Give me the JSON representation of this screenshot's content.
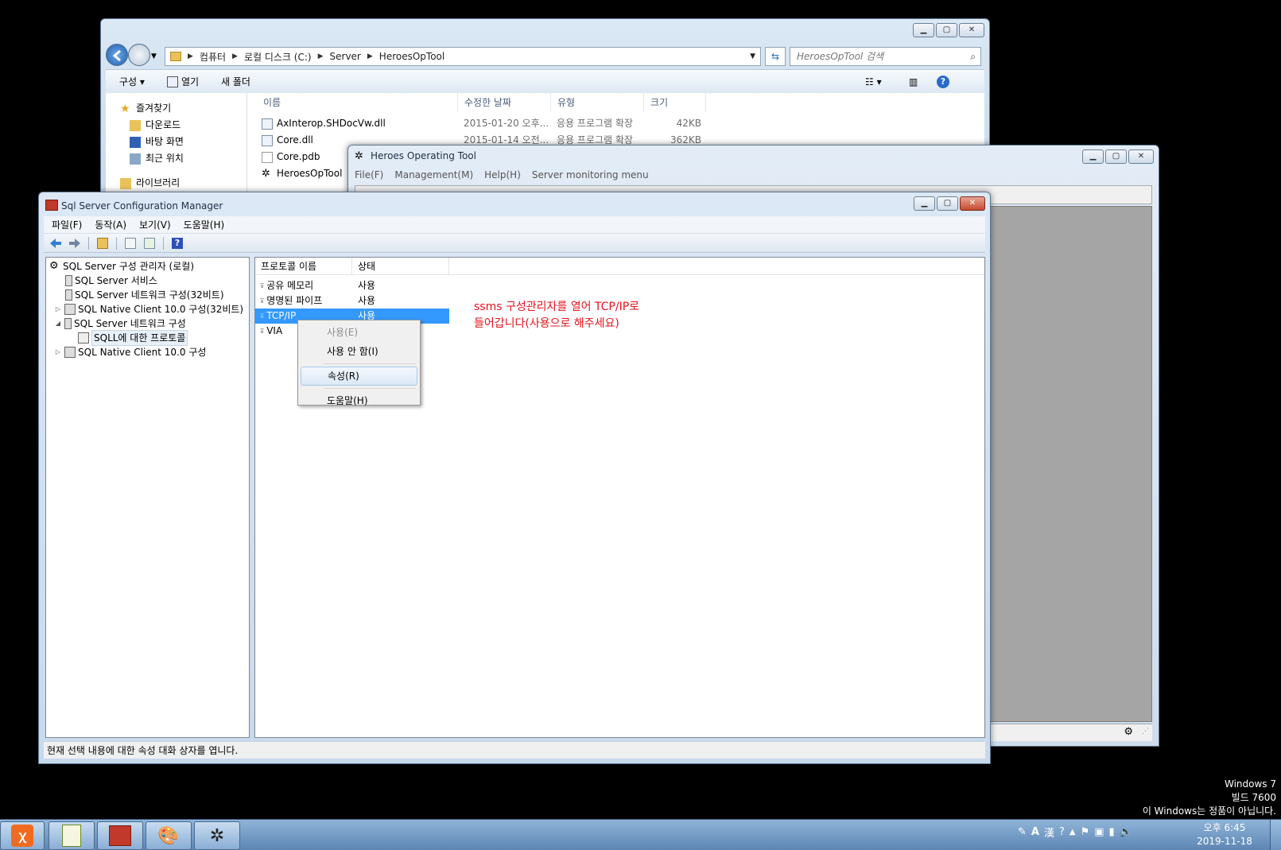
{
  "explorer": {
    "breadcrumb": [
      "컴퓨터",
      "로컬 디스크 (C:)",
      "Server",
      "HeroesOpTool"
    ],
    "search_placeholder": "HeroesOpTool 검색",
    "toolbar": {
      "organize": "구성",
      "open": "열기",
      "new_folder": "새 폴더"
    },
    "nav": {
      "favorites": "즐겨찾기",
      "downloads": "다운로드",
      "desktop": "바탕 화면",
      "recent": "최근 위치",
      "libraries": "라이브러리"
    },
    "columns": {
      "name": "이름",
      "date": "수정한 날짜",
      "type": "유형",
      "size": "크기"
    },
    "files": [
      {
        "name": "AxInterop.SHDocVw.dll",
        "date": "2015-01-20 오후...",
        "type": "응용 프로그램 확장",
        "size": "42KB"
      },
      {
        "name": "Core.dll",
        "date": "2015-01-14 오전...",
        "type": "응용 프로그램 확장",
        "size": "362KB"
      },
      {
        "name": "Core.pdb",
        "date": "",
        "type": "",
        "size": ""
      },
      {
        "name": "HeroesOpTool",
        "date": "",
        "type": "",
        "size": ""
      }
    ]
  },
  "heroes": {
    "title": "Heroes Operating Tool",
    "menu": {
      "file": "File(F)",
      "management": "Management(M)",
      "help": "Help(H)",
      "monitor": "Server monitoring menu"
    }
  },
  "sscm": {
    "title": "Sql Server Configuration Manager",
    "menu": {
      "file": "파일(F)",
      "action": "동작(A)",
      "view": "보기(V)",
      "help": "도움말(H)"
    },
    "tree": {
      "root": "SQL Server 구성 관리자 (로컬)",
      "services": "SQL Server 서비스",
      "net32": "SQL Server 네트워크 구성(32비트)",
      "native32": "SQL Native Client 10.0 구성(32비트)",
      "net": "SQL Server 네트워크 구성",
      "protocols": "SQLL에 대한 프로토콜",
      "native": "SQL Native Client 10.0 구성"
    },
    "columns": {
      "protocol": "프로토콜 이름",
      "status": "상태"
    },
    "rows": [
      {
        "name": "공유 메모리",
        "status": "사용"
      },
      {
        "name": "명명된 파이프",
        "status": "사용"
      },
      {
        "name": "TCP/IP",
        "status": "사용"
      },
      {
        "name": "VIA",
        "status": ""
      }
    ],
    "annotation": {
      "line1": "ssms 구성관리자를 열어 TCP/IP로",
      "line2": "들어갑니다(사용으로 해주세요)"
    },
    "status_text": "현재 선택 내용에 대한 속성 대화 상자를 엽니다."
  },
  "context_menu": {
    "enable": "사용(E)",
    "disable": "사용 안 함(I)",
    "properties": "속성(R)",
    "help": "도움말(H)"
  },
  "watermark": {
    "line1": "Windows 7",
    "line2": "빌드 7600",
    "line3": "이 Windows는 정품이 아닙니다."
  },
  "taskbar": {
    "time": "오후 6:45",
    "date": "2019-11-18",
    "ime_a": "A",
    "ime_han": "漢"
  },
  "colors": {
    "selection": "#3399ff",
    "annotation": "#e8121b",
    "taskbar": "#6f97c4"
  }
}
